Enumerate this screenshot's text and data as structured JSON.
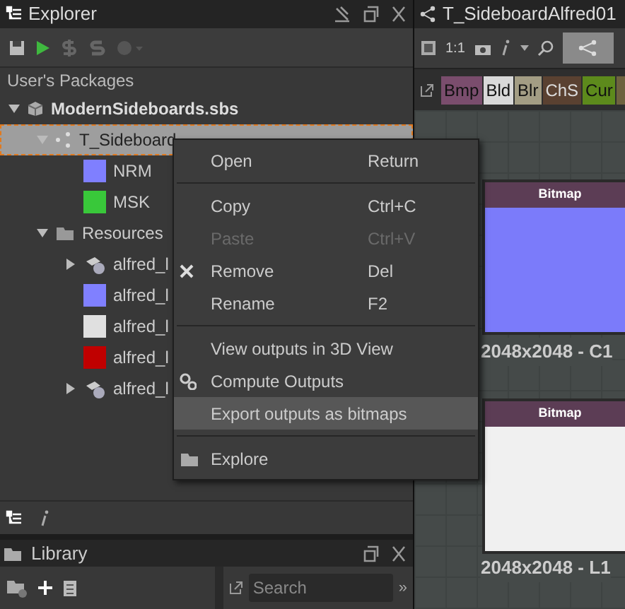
{
  "explorer": {
    "title": "Explorer",
    "section": "User's Packages",
    "tree": [
      {
        "label": "ModernSideboards.sbs",
        "kind": "package",
        "expanded": true,
        "selected": false,
        "children": [
          {
            "label": "T_Sideboard",
            "kind": "graph",
            "expanded": true,
            "selected": true,
            "children": [
              {
                "label": "NRM",
                "kind": "thumb",
                "color": "#7f7fff",
                "selected": false
              },
              {
                "label": "MSK",
                "kind": "thumb",
                "color": "#39c83a",
                "selected": false
              }
            ]
          },
          {
            "label": "Resources",
            "kind": "folder",
            "expanded": true,
            "selected": false,
            "children": [
              {
                "label": "alfred_l",
                "kind": "mesh",
                "expanded": false,
                "selected": false
              },
              {
                "label": "alfred_l",
                "kind": "thumb",
                "color": "#8080ff",
                "selected": false
              },
              {
                "label": "alfred_l",
                "kind": "thumb",
                "color": "#e0e0e0",
                "selected": false
              },
              {
                "label": "alfred_l",
                "kind": "thumb",
                "color": "#c00000",
                "selected": false
              },
              {
                "label": "alfred_l",
                "kind": "mesh",
                "expanded": false,
                "selected": false
              }
            ]
          }
        ]
      }
    ]
  },
  "context_menu": [
    {
      "kind": "item",
      "label": "Open",
      "shortcut": "Return",
      "disabled": false,
      "selected": false
    },
    {
      "kind": "separator"
    },
    {
      "kind": "item",
      "label": "Copy",
      "shortcut": "Ctrl+C",
      "disabled": false,
      "selected": false
    },
    {
      "kind": "item",
      "label": "Paste",
      "shortcut": "Ctrl+V",
      "disabled": true,
      "selected": false
    },
    {
      "kind": "item",
      "label": "Remove",
      "shortcut": "Del",
      "disabled": false,
      "selected": false
    },
    {
      "kind": "item",
      "label": "Rename",
      "shortcut": "F2",
      "disabled": false,
      "selected": false
    },
    {
      "kind": "separator"
    },
    {
      "kind": "item",
      "label": "View outputs in 3D View",
      "disabled": false,
      "selected": false
    },
    {
      "kind": "item",
      "label": "Compute Outputs",
      "disabled": false,
      "selected": false
    },
    {
      "kind": "item",
      "label": "Export outputs as bitmaps",
      "disabled": false,
      "selected": true
    },
    {
      "kind": "separator"
    },
    {
      "kind": "item",
      "label": "Explore",
      "disabled": false,
      "selected": false
    }
  ],
  "library": {
    "title": "Library",
    "search": {
      "placeholder": "Search"
    },
    "more": "»"
  },
  "graph": {
    "title": "T_SideboardAlfred01",
    "zoom_label": "1:1",
    "connection_toggle": {
      "on": true
    },
    "node_chips": [
      {
        "label": "Bmp",
        "color": "#7a4d6d"
      },
      {
        "label": "Bld",
        "color": "#d9d9d9"
      },
      {
        "label": "Blr",
        "color": "#a39d84"
      },
      {
        "label": "ChS",
        "color": "#5a4131"
      },
      {
        "label": "Cur",
        "color": "#5d8a1c"
      }
    ],
    "nodes": [
      {
        "header": "Bitmap",
        "caption": "2048x2048 - C1",
        "color": "#7b7bfa"
      },
      {
        "header": "Bitmap",
        "caption": "2048x2048 - L1",
        "color": "#f0f0f0"
      }
    ]
  }
}
